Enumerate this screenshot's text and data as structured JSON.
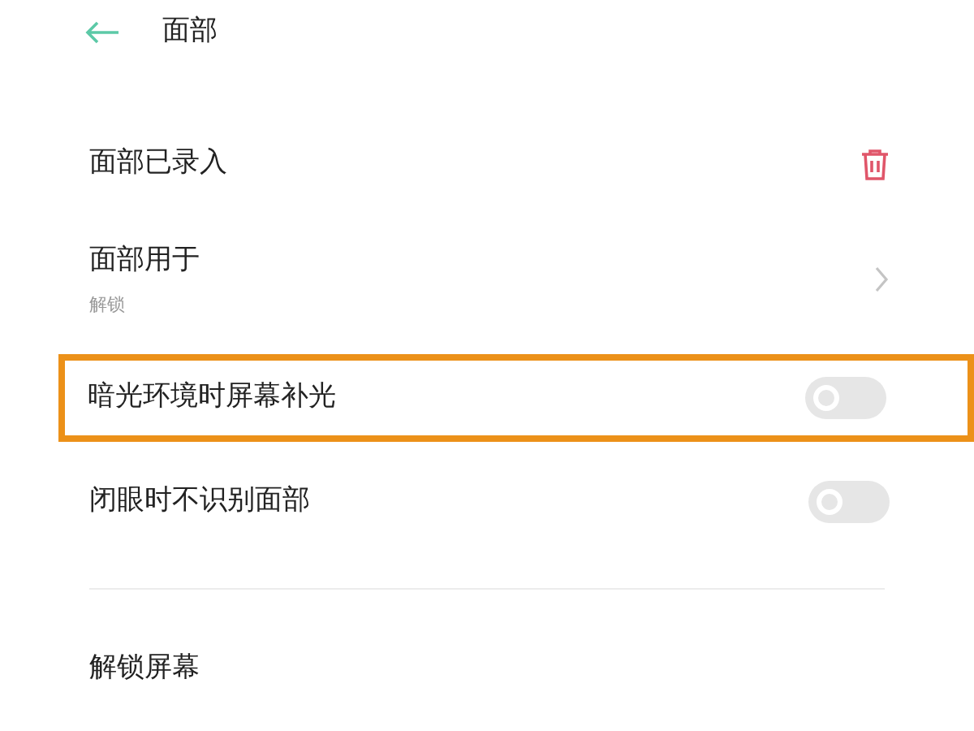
{
  "header": {
    "title": "面部"
  },
  "items": [
    {
      "kind": "delete",
      "label": "面部已录入",
      "highlighted": false
    },
    {
      "kind": "link",
      "label": "面部用于",
      "subtitle": "解锁",
      "highlighted": false
    },
    {
      "kind": "toggle",
      "label": "暗光环境时屏幕补光",
      "on": false,
      "highlighted": true
    },
    {
      "kind": "toggle",
      "label": "闭眼时不识别面部",
      "on": false,
      "highlighted": false
    }
  ],
  "section": {
    "label": "解锁屏幕"
  }
}
